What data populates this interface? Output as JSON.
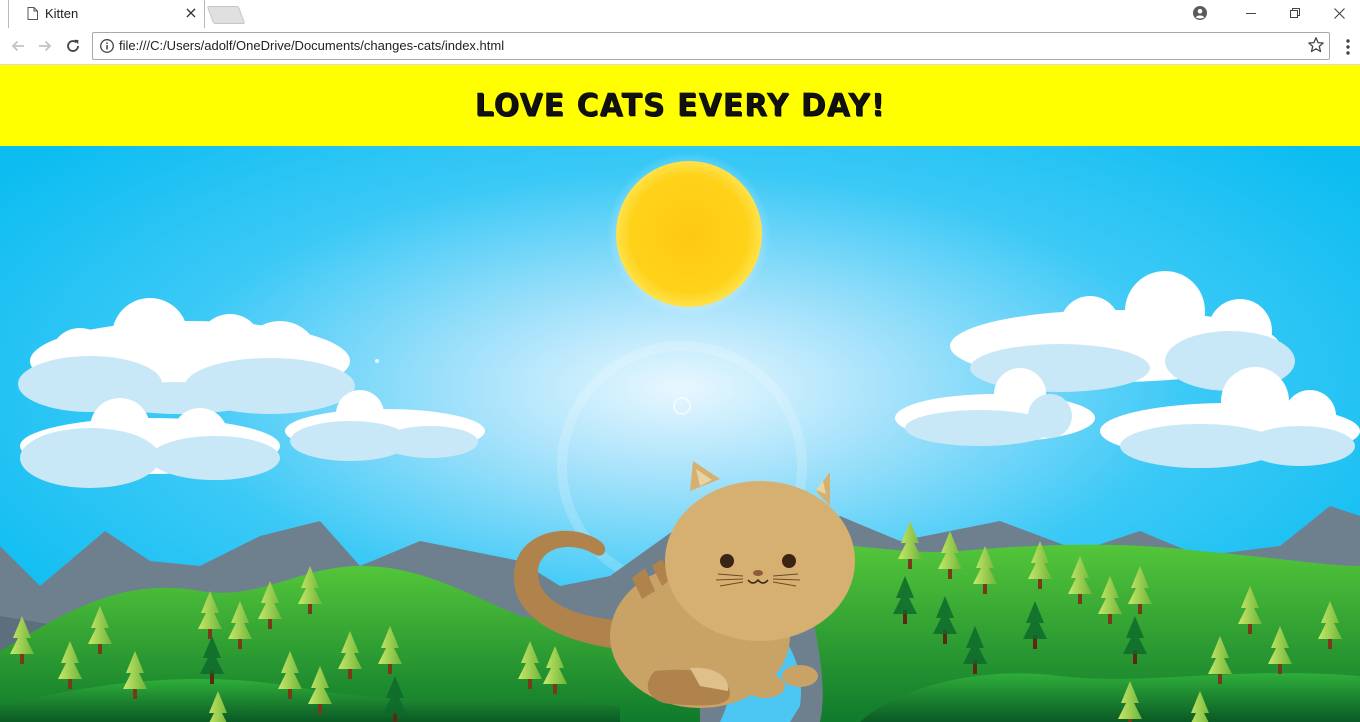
{
  "browser": {
    "tab_title": "Kitten",
    "tab_close_glyph": "×",
    "url": "file:///C:/Users/adolf/OneDrive/Documents/changes-cats/index.html",
    "icons": {
      "tab": "page-icon",
      "back": "arrow-left-icon",
      "forward": "arrow-right-icon",
      "reload": "reload-icon",
      "info": "info-icon",
      "bookmark": "star-icon",
      "menu": "kebab-menu-icon",
      "profile": "profile-icon",
      "minimize": "minimize-icon",
      "maximize": "restore-icon",
      "close": "close-icon"
    }
  },
  "page": {
    "heading": "Love cats every day!",
    "banner_color": "#ffff00",
    "scene": {
      "sky_color": "#12c1f2",
      "sun_color": "#ffd21a",
      "cat_color": "#d6b070"
    }
  }
}
